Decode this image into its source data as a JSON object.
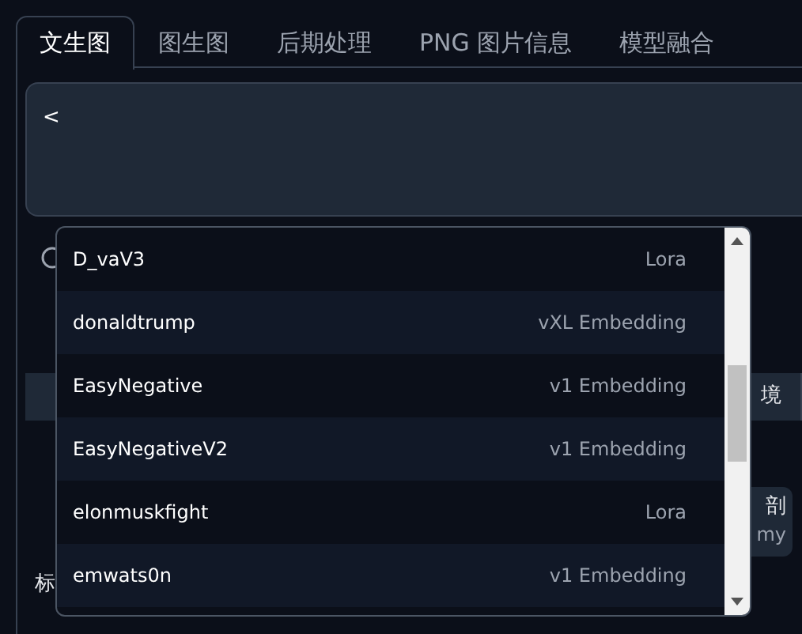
{
  "tabs": [
    {
      "label": "文生图",
      "selected": true
    },
    {
      "label": "图生图",
      "selected": false
    },
    {
      "label": "后期处理",
      "selected": false
    },
    {
      "label": "PNG 图片信息",
      "selected": false
    },
    {
      "label": "模型融合",
      "selected": false
    }
  ],
  "prompt": {
    "value": "<"
  },
  "background": {
    "tab_label": "境",
    "button_label": "剖",
    "button_sublabel": "my",
    "section_label": "标"
  },
  "autocomplete": {
    "items": [
      {
        "name": "D_vaV3",
        "type": "Lora"
      },
      {
        "name": "donaldtrump",
        "type": "vXL Embedding"
      },
      {
        "name": "EasyNegative",
        "type": "v1 Embedding"
      },
      {
        "name": "EasyNegativeV2",
        "type": "v1 Embedding"
      },
      {
        "name": "elonmuskfight",
        "type": "Lora"
      },
      {
        "name": "emwats0n",
        "type": "v1 Embedding"
      }
    ]
  }
}
